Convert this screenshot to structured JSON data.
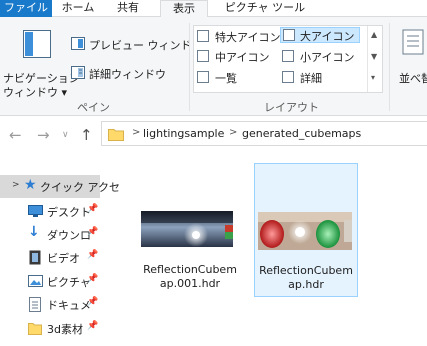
{
  "ribbon_tabs": [
    "ファイル",
    "ホーム",
    "共有",
    "表示",
    "ピクチャ ツール"
  ],
  "ribbon": {
    "nav_pane_label": "ナビゲーション\nウィンドウ",
    "nav_pane_line1": "ナビゲーション",
    "nav_pane_line2": "ウィンドウ ▾",
    "preview_label": "プレビュー ウィンドウ",
    "details_pane_label": "詳細ウィンドウ",
    "pane_group": "ペイン",
    "layout_items": {
      "extra_large": "特大アイコン",
      "large": "大アイコン",
      "medium": "中アイコン",
      "small": "小アイコン",
      "list": "一覧",
      "details": "詳細"
    },
    "layout_group": "レイアウト",
    "sort_label": "並べ替"
  },
  "breadcrumb": {
    "separator": ">",
    "items": [
      "lightingsample",
      "generated_cubemaps"
    ]
  },
  "nav_pane": {
    "items": [
      {
        "label": "クイック アクセ",
        "icon": "star-icon"
      },
      {
        "label": "デスクト",
        "icon": "desktop-icon"
      },
      {
        "label": "ダウンロ",
        "icon": "download-icon"
      },
      {
        "label": "ビデオ",
        "icon": "video-icon"
      },
      {
        "label": "ピクチャ",
        "icon": "picture-icon"
      },
      {
        "label": "ドキュメ",
        "icon": "document-icon"
      },
      {
        "label": "3d素材",
        "icon": "folder-icon"
      }
    ]
  },
  "files": [
    {
      "name_line1": "ReflectionCubem",
      "name_line2": "ap.001.hdr",
      "selected": false
    },
    {
      "name_line1": "ReflectionCubem",
      "name_line2": "ap.hdr",
      "selected": true
    }
  ],
  "colors": {
    "file_tab": "#1979ca",
    "selection_bg": "#cce8ff",
    "selection_border": "#99d1ff"
  }
}
